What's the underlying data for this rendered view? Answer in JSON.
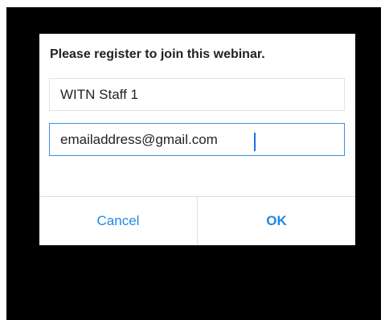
{
  "dialog": {
    "title": "Please register to join this webinar.",
    "name_value": "WITN Staff 1",
    "email_value": "emailaddress@gmail.com",
    "cancel_label": "Cancel",
    "ok_label": "OK"
  },
  "colors": {
    "backdrop": "#000000",
    "accent": "#1e88e5",
    "focus_border": "#3d8fe0"
  }
}
